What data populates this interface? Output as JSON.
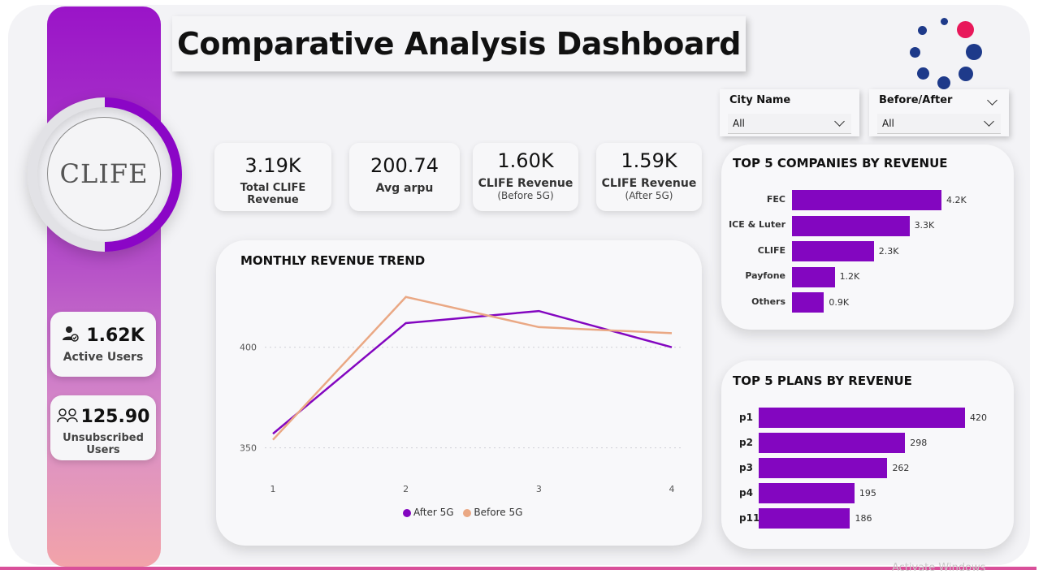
{
  "dashboard": {
    "title": "Comparative Analysis Dashboard",
    "logo_text": "CLIFE",
    "watermark": "Activate Windows"
  },
  "side_cards": {
    "active_users": {
      "value": "1.62K",
      "label": "Active Users",
      "icon": "user-check-icon"
    },
    "unsubscribed_users": {
      "value": "125.90",
      "label": "Unsubscribed Users",
      "icon": "users-group-icon"
    }
  },
  "kpis": [
    {
      "value": "3.19K",
      "label": "Total CLIFE Revenue",
      "sublabel": ""
    },
    {
      "value": "200.74",
      "label": "Avg arpu",
      "sublabel": ""
    },
    {
      "value": "1.60K",
      "label": "CLIFE Revenue",
      "sublabel": "(Before 5G)"
    },
    {
      "value": "1.59K",
      "label": "CLIFE Revenue",
      "sublabel": "(After 5G)"
    }
  ],
  "filters": {
    "city": {
      "label": "City Name",
      "selected": "All"
    },
    "before_after": {
      "label": "Before/After",
      "selected": "All"
    }
  },
  "colors": {
    "accent": "#8306c0",
    "before": "#eaa884",
    "after": "#8306c0",
    "spinner_dot": "#1e3a8a",
    "spinner_highlight": "#e8185a"
  },
  "chart_data": [
    {
      "type": "line",
      "title": "MONTHLY REVENUE TREND",
      "x": [
        1,
        2,
        3,
        4
      ],
      "series": [
        {
          "name": "After 5G",
          "values": [
            357,
            412,
            418,
            400
          ]
        },
        {
          "name": "Before 5G",
          "values": [
            354,
            425,
            410,
            407
          ]
        }
      ],
      "xlabel": "",
      "ylabel": "",
      "yticks": [
        350,
        400
      ],
      "ylim": [
        345,
        437
      ],
      "grid": true,
      "legend": "bottom"
    },
    {
      "type": "bar",
      "orientation": "horizontal",
      "title": "TOP 5 COMPANIES BY REVENUE",
      "categories": [
        "FEC",
        "ICE & Luter",
        "CLIFE",
        "Payfone",
        "Others"
      ],
      "values": [
        4200,
        3300,
        2300,
        1200,
        900
      ],
      "data_labels": [
        "4.2K",
        "3.3K",
        "2.3K",
        "1.2K",
        "0.9K"
      ]
    },
    {
      "type": "bar",
      "orientation": "horizontal",
      "title": "TOP 5 PLANS BY REVENUE",
      "categories": [
        "p1",
        "p2",
        "p3",
        "p4",
        "p11"
      ],
      "values": [
        420,
        298,
        262,
        195,
        186
      ],
      "data_labels": [
        "420",
        "298",
        "262",
        "195",
        "186"
      ]
    }
  ]
}
